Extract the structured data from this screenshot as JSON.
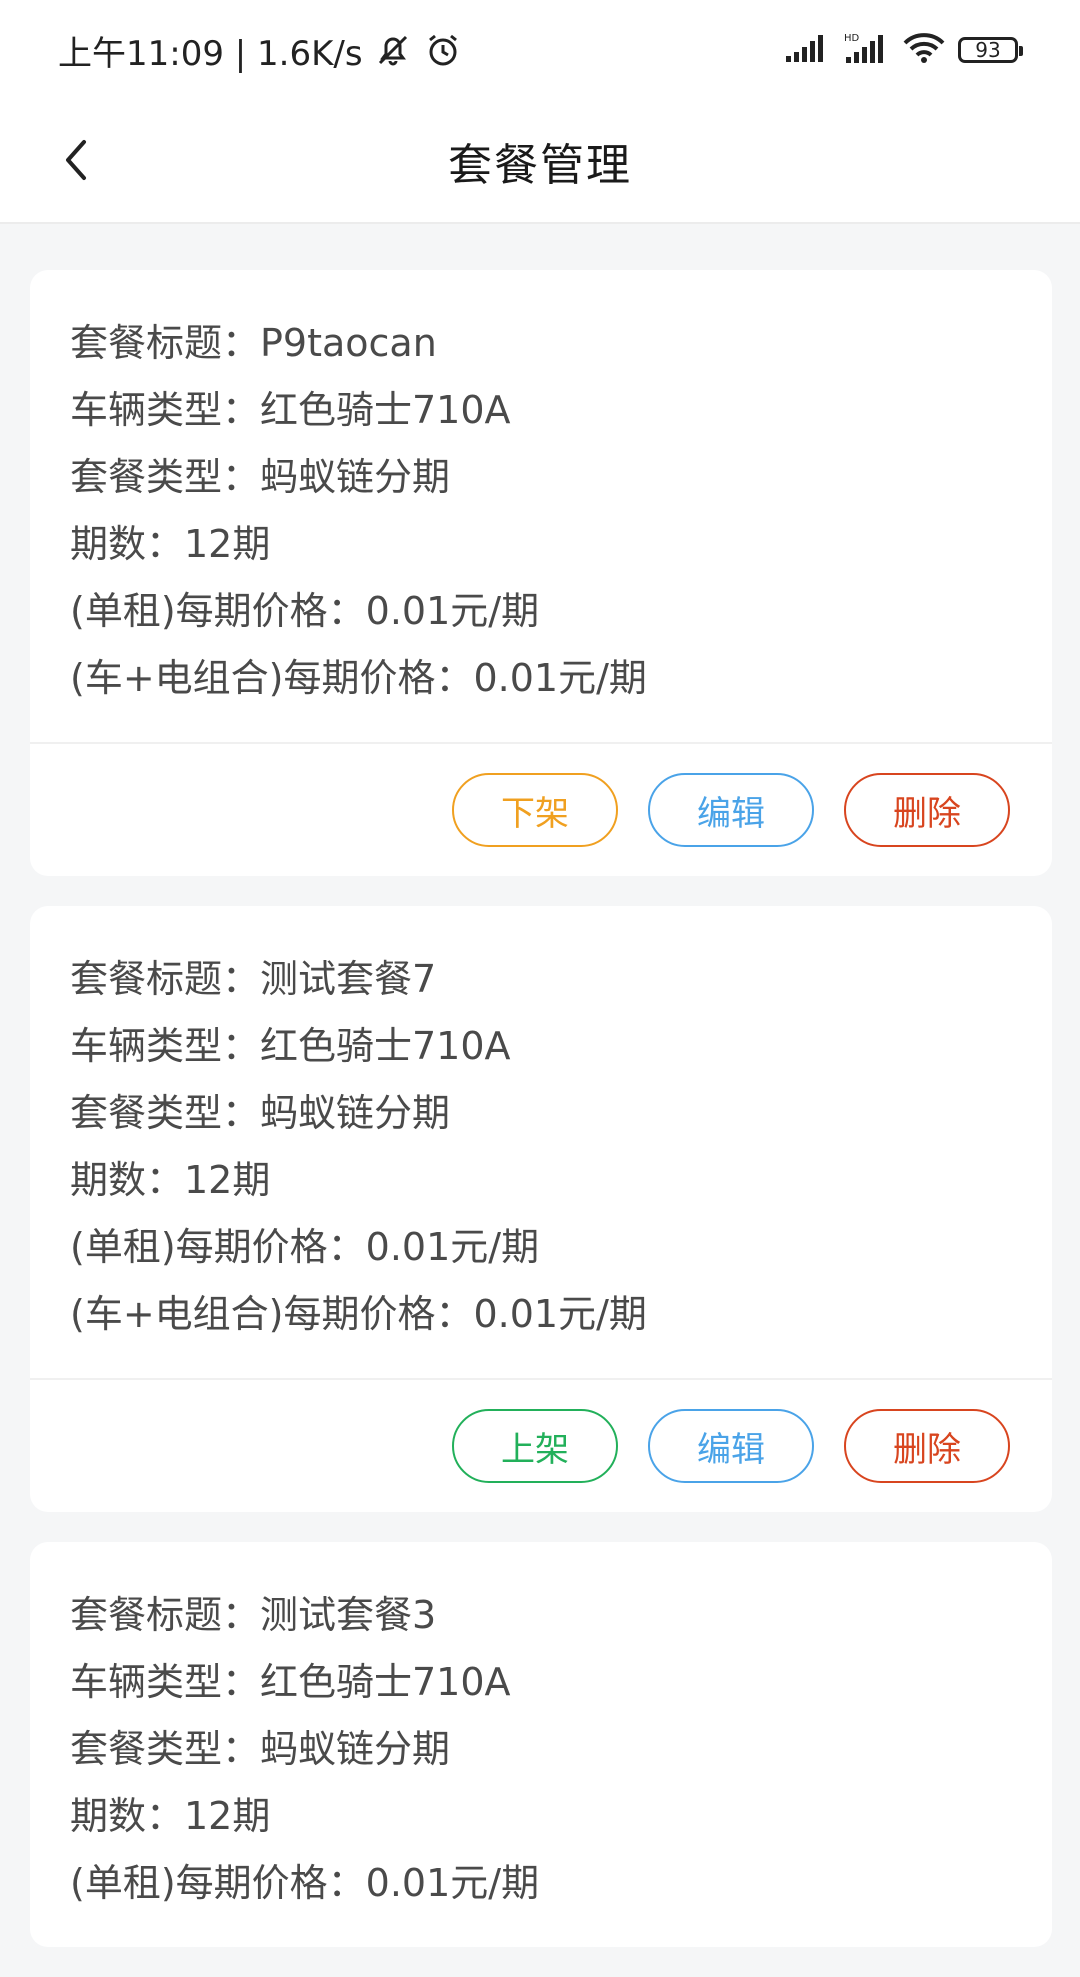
{
  "status_bar": {
    "time_speed": "上午11:09 | 1.6K/s",
    "battery": "93",
    "icons": [
      "mute-bell-icon",
      "alarm-icon",
      "signal-icon",
      "hd-signal-icon",
      "wifi-icon",
      "battery-icon"
    ]
  },
  "header": {
    "title": "套餐管理",
    "back_icon": "chevron-left-icon"
  },
  "colors": {
    "offline": "#f0a020",
    "online": "#22b05a",
    "edit": "#4aa3e8",
    "delete": "#d8451f"
  },
  "packages": [
    {
      "rows": [
        "套餐标题：P9taocan",
        "车辆类型：红色骑士710A",
        "套餐类型：蚂蚁链分期",
        "期数：12期",
        "(单租)每期价格：0.01元/期",
        "(车+电组合)每期价格：0.01元/期"
      ],
      "toggle_label": "下架",
      "toggle_kind": "offline",
      "edit_label": "编辑",
      "delete_label": "删除"
    },
    {
      "rows": [
        "套餐标题：测试套餐7",
        "车辆类型：红色骑士710A",
        "套餐类型：蚂蚁链分期",
        "期数：12期",
        "(单租)每期价格：0.01元/期",
        "(车+电组合)每期价格：0.01元/期"
      ],
      "toggle_label": "上架",
      "toggle_kind": "online",
      "edit_label": "编辑",
      "delete_label": "删除"
    },
    {
      "rows": [
        "套餐标题：测试套餐3",
        "车辆类型：红色骑士710A",
        "套餐类型：蚂蚁链分期",
        "期数：12期",
        "(单租)每期价格：0.01元/期"
      ],
      "toggle_label": "",
      "toggle_kind": "",
      "edit_label": "",
      "delete_label": ""
    }
  ]
}
